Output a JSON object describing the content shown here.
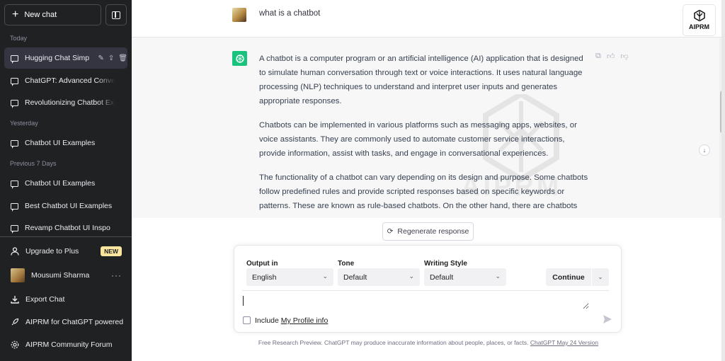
{
  "sidebar": {
    "new_chat": "New chat",
    "sections": {
      "today": "Today",
      "yesterday": "Yesterday",
      "previous": "Previous 7 Days"
    },
    "today_items": [
      "Hugging Chat Simpli",
      "ChatGPT: Advanced Conversa",
      "Revolutionizing Chatbot Exper"
    ],
    "yesterday_items": [
      "Chatbot UI Examples"
    ],
    "previous_items": [
      "Chatbot UI Examples",
      "Best Chatbot UI Examples",
      "Revamp Chatbot UI Inspo"
    ],
    "upgrade": "Upgrade to Plus",
    "upgrade_badge": "NEW",
    "user_name": "Mousumi Sharma",
    "export": "Export Chat",
    "aiprm_powered": "AIPRM for ChatGPT powered",
    "aiprm_forum": "AIPRM Community Forum"
  },
  "conversation": {
    "user_message": "what is a chatbot",
    "assistant_paragraphs": [
      "A chatbot is a computer program or an artificial intelligence (AI) application that is designed to simulate human conversation through text or voice interactions. It uses natural language processing (NLP) techniques to understand and interpret user inputs and generates appropriate responses.",
      "Chatbots can be implemented in various platforms such as messaging apps, websites, or voice assistants. They are commonly used to automate customer service interactions, provide information, assist with tasks, and engage in conversational experiences.",
      "The functionality of a chatbot can vary depending on its design and purpose. Some chatbots follow predefined rules and provide scripted responses based on specific keywords or patterns. These are known as rule-based chatbots. On the other hand, there are chatbots"
    ]
  },
  "aiprm_badge": "AIPRM",
  "watermark": "AIPRM",
  "composer": {
    "regenerate": "Regenerate response",
    "output_label": "Output in",
    "output_value": "English",
    "tone_label": "Tone",
    "tone_value": "Default",
    "style_label": "Writing Style",
    "style_value": "Default",
    "continue": "Continue",
    "include_prefix": "Include",
    "include_link": "My Profile info"
  },
  "footer": {
    "disclaimer": "Free Research Preview. ChatGPT may produce inaccurate information about people, places, or facts.",
    "version_link": "ChatGPT May 24 Version"
  },
  "colors": {
    "sidebar_bg": "#202123",
    "gpt_green": "#19c37d",
    "new_badge": "#fae69e"
  }
}
